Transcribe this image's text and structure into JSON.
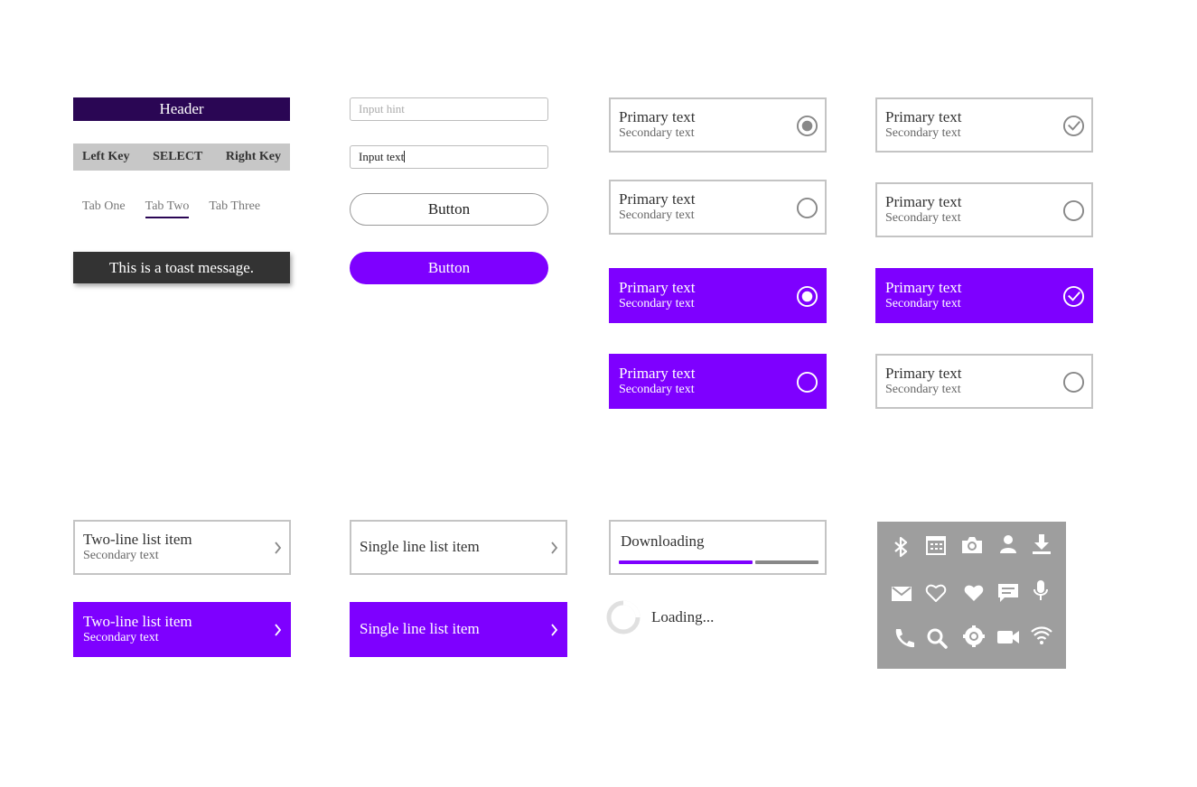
{
  "header": {
    "title": "Header"
  },
  "softkeys": {
    "left": "Left Key",
    "center": "SELECT",
    "right": "Right Key"
  },
  "tabs": [
    "Tab One",
    "Tab Two",
    "Tab Three"
  ],
  "active_tab": "Tab Two",
  "toast": {
    "message": "This is a toast message."
  },
  "inputs": {
    "hint": "Input hint",
    "text": "Input text"
  },
  "buttons": {
    "outline": "Button",
    "filled": "Button"
  },
  "cards": {
    "primary": "Primary text",
    "secondary": "Secondary text"
  },
  "lists": {
    "two_line": "Two-line list item",
    "two_line_secondary": "Secondary text",
    "single_line": "Single line list item"
  },
  "progress": {
    "label": "Downloading",
    "value": 0.67
  },
  "loading": {
    "label": "Loading..."
  },
  "colors": {
    "accent": "#7e00ff",
    "header": "#2a0654",
    "toast": "#333333",
    "icon_panel": "#9e9e9e"
  },
  "icons": [
    "bluetooth-icon",
    "calendar-icon",
    "camera-icon",
    "contact-icon",
    "download-icon",
    "email-icon",
    "heart-outline-icon",
    "heart-icon",
    "message-icon",
    "microphone-icon",
    "phone-icon",
    "search-icon",
    "settings-icon",
    "video-icon",
    "wifi-icon"
  ]
}
